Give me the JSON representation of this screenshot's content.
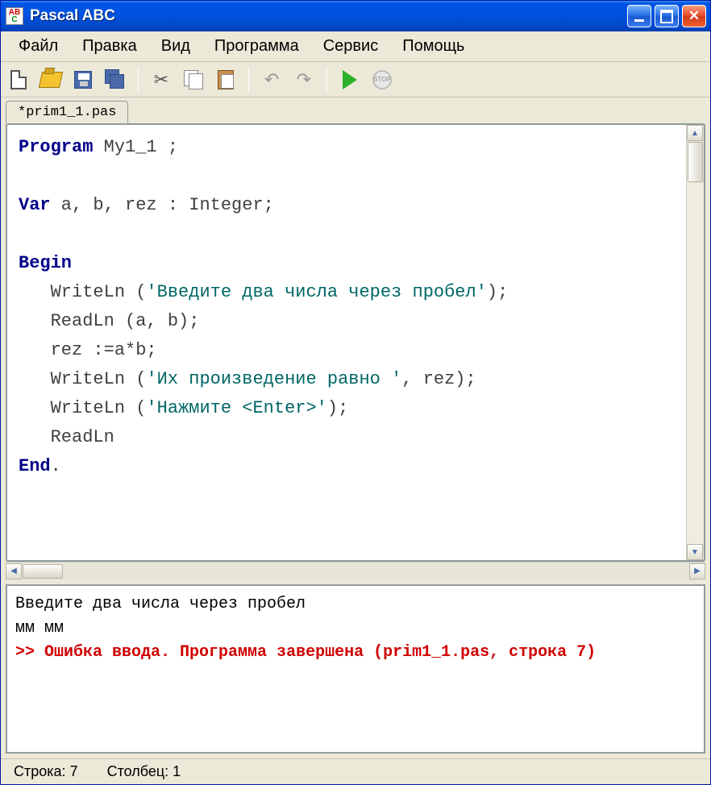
{
  "title": "Pascal ABC",
  "menu": {
    "file": "Файл",
    "edit": "Правка",
    "view": "Вид",
    "program": "Программа",
    "service": "Сервис",
    "help": "Помощь"
  },
  "tab": "*prim1_1.pas",
  "code": {
    "l1_kw": "Program",
    "l1_rest": " My1_1 ;",
    "l2_kw": "Var",
    "l2_rest": " a, b, rez : Integer;",
    "l3_kw": "Begin",
    "l4a": "   WriteLn (",
    "l4s": "'Введите два числа через пробел'",
    "l4b": ");",
    "l5": "   ReadLn (a, b);",
    "l6": "   rez :=a*b;",
    "l7a": "   WriteLn (",
    "l7s": "'Их произведение равно '",
    "l7b": ", rez);",
    "l8a": "   WriteLn (",
    "l8s": "'Нажмите <Enter>'",
    "l8b": ");",
    "l9": "   ReadLn",
    "l10_kw": "End",
    "l10_rest": "."
  },
  "console": {
    "line1": "Введите два числа через пробел",
    "line2": "мм мм",
    "err_prefix": ">> ",
    "err_text": "Ошибка ввода. Программа завершена (prim1_1.pas, строка 7)"
  },
  "status": {
    "line_label": "Строка: ",
    "line_val": "7",
    "col_label": "Столбец: ",
    "col_val": "1"
  },
  "icons": {
    "stop_text": "STOP"
  }
}
